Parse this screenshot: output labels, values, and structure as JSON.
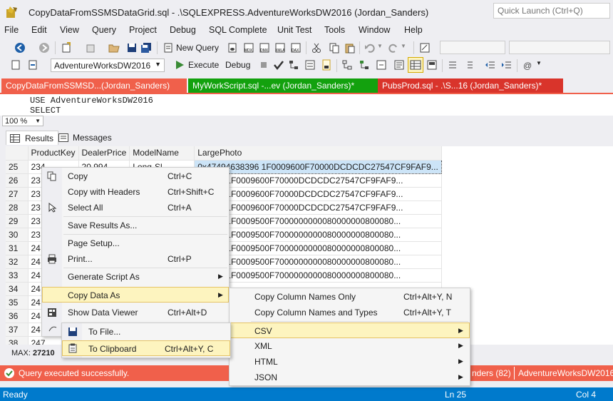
{
  "window": {
    "title": "CopyDataFromSSMSDataGrid.sql - .\\SQLEXPRESS.AdventureWorksDW2016 (Jordan_Sanders)",
    "quick_launch_placeholder": "Quick Launch (Ctrl+Q)"
  },
  "menubar": [
    "File",
    "Edit",
    "View",
    "Query",
    "Project",
    "Debug",
    "SQL Complete",
    "Unit Test",
    "Tools",
    "Window",
    "Help"
  ],
  "toolbar": {
    "new_query": "New Query",
    "database": "AdventureWorksDW2016",
    "execute": "Execute",
    "debug": "Debug"
  },
  "tabs": [
    {
      "label": "CopyDataFromSSMSD...(Jordan_Sanders)",
      "color": "#f0604b"
    },
    {
      "label": "MyWorkScript.sql -...ev (Jordan_Sanders)*",
      "color": "#13a10e"
    },
    {
      "label": "PubsProd.sql - .\\S...16 (Jordan_Sanders)*",
      "color": "#d9342b"
    }
  ],
  "editor": {
    "lines": [
      "USE AdventureWorksDW2016",
      "SELECT"
    ]
  },
  "zoom": "100 %",
  "result_tabs": {
    "results": "Results",
    "messages": "Messages"
  },
  "grid": {
    "headers": [
      "",
      "ProductKey",
      "DealerPrice",
      "ModelName",
      "LargePhoto"
    ],
    "rows": [
      [
        "25",
        "234",
        "20.994",
        "Long-Sl...",
        "0x47494638396 1F0009600F70000DCDCDC27547CF9FAF9..."
      ],
      [
        "26",
        "23",
        "",
        "",
        "6383961F0009600F70000DCDCDC27547CF9FAF9..."
      ],
      [
        "27",
        "23",
        "",
        "",
        "6383961F0009600F70000DCDCDC27547CF9FAF9..."
      ],
      [
        "28",
        "23",
        "",
        "",
        "6383961F0009600F70000DCDCDC27547CF9FAF9..."
      ],
      [
        "29",
        "23",
        "",
        "",
        "6383961F0009500F7000000000080000000800080..."
      ],
      [
        "30",
        "23",
        "",
        "",
        "6383961F0009500F7000000000080000000800080..."
      ],
      [
        "31",
        "24",
        "",
        "",
        "6383961F0009500F7000000000080000000800080..."
      ],
      [
        "32",
        "24",
        "",
        "",
        "6383961F0009500F7000000000080000000800080..."
      ],
      [
        "33",
        "24",
        "",
        "",
        "6383961F0009500F7000000000080000000800080..."
      ],
      [
        "34",
        "24",
        "",
        "",
        ""
      ],
      [
        "35",
        "24",
        "",
        "",
        ""
      ],
      [
        "36",
        "24",
        "",
        "",
        ""
      ],
      [
        "37",
        "24",
        "",
        "",
        ""
      ],
      [
        "38",
        "247",
        "",
        "",
        ""
      ]
    ]
  },
  "stats": {
    "max_label": "MAX:",
    "max_value": "27210"
  },
  "exec_status": {
    "message": "Query executed successfully.",
    "right1": "nders (82)",
    "right2": "AdventureWorksDW2016"
  },
  "statusbar": {
    "left": "Ready",
    "ln": "Ln 25",
    "col": "Col 4"
  },
  "context_menu": {
    "items": [
      {
        "label": "Copy",
        "shortcut": "Ctrl+C"
      },
      {
        "label": "Copy with Headers",
        "shortcut": "Ctrl+Shift+C"
      },
      {
        "label": "Select All",
        "shortcut": "Ctrl+A"
      },
      {
        "label": "Save Results As...",
        "shortcut": ""
      },
      {
        "label": "Page Setup...",
        "shortcut": ""
      },
      {
        "label": "Print...",
        "shortcut": "Ctrl+P"
      },
      {
        "label": "Generate Script As",
        "shortcut": ""
      },
      {
        "label": "Copy Data As",
        "shortcut": ""
      },
      {
        "label": "Show Data Viewer",
        "shortcut": "Ctrl+Alt+D"
      }
    ]
  },
  "copy_data_submenu": {
    "items": [
      {
        "label": "Copy Column Names Only",
        "shortcut": "Ctrl+Alt+Y, N"
      },
      {
        "label": "Copy Column Names and Types",
        "shortcut": "Ctrl+Alt+Y, T"
      },
      {
        "label": "CSV",
        "shortcut": ""
      },
      {
        "label": "XML",
        "shortcut": ""
      },
      {
        "label": "HTML",
        "shortcut": ""
      },
      {
        "label": "JSON",
        "shortcut": ""
      }
    ]
  },
  "csv_submenu": {
    "items": [
      {
        "label": "To File...",
        "shortcut": ""
      },
      {
        "label": "To Clipboard",
        "shortcut": "Ctrl+Alt+Y, C"
      }
    ]
  }
}
